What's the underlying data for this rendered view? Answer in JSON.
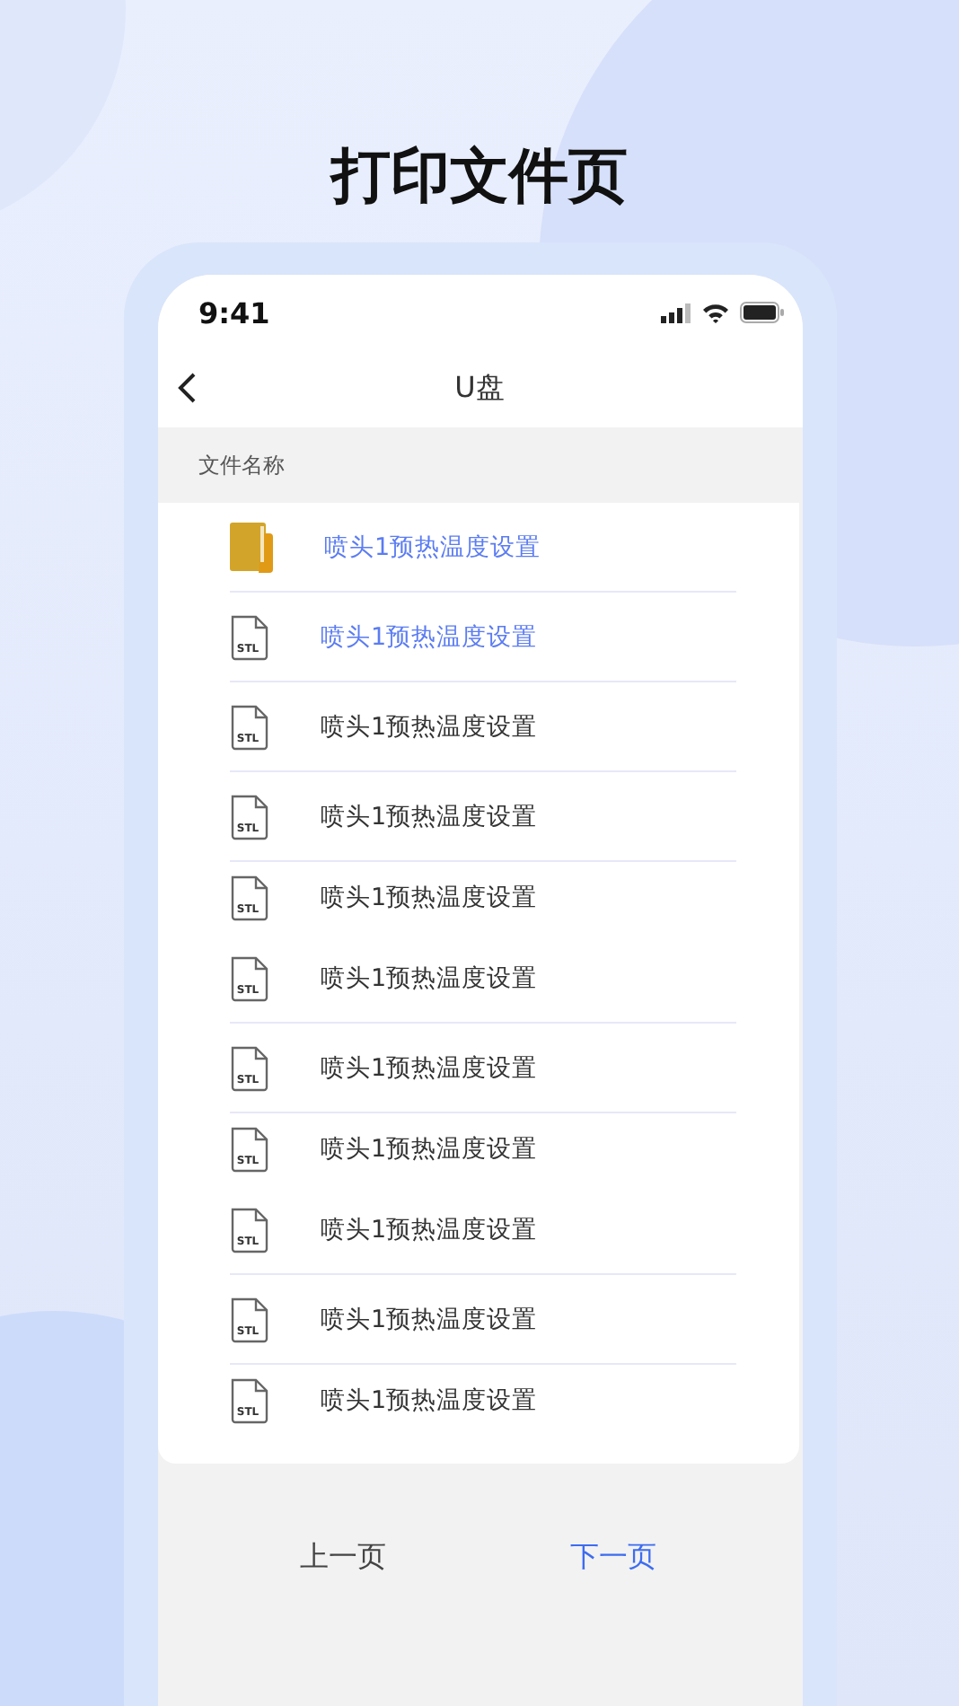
{
  "page_title": "打印文件页",
  "status_bar": {
    "time": "9:41"
  },
  "nav": {
    "title": "U盘"
  },
  "list_header": "文件名称",
  "files": [
    {
      "kind": "folder",
      "name": "喷头1预热温度设置",
      "selected": true,
      "divider": true
    },
    {
      "kind": "stl",
      "badge": "STL",
      "name": "喷头1预热温度设置",
      "selected": true,
      "divider": true
    },
    {
      "kind": "stl",
      "badge": "STL",
      "name": "喷头1预热温度设置",
      "selected": false,
      "divider": true
    },
    {
      "kind": "stl",
      "badge": "STL",
      "name": "喷头1预热温度设置",
      "selected": false,
      "divider": true
    },
    {
      "kind": "stl",
      "badge": "STL",
      "name": "喷头1预热温度设置",
      "selected": false,
      "divider": false
    },
    {
      "kind": "stl",
      "badge": "STL",
      "name": "喷头1预热温度设置",
      "selected": false,
      "divider": true
    },
    {
      "kind": "stl",
      "badge": "STL",
      "name": "喷头1预热温度设置",
      "selected": false,
      "divider": true
    },
    {
      "kind": "stl",
      "badge": "STL",
      "name": "喷头1预热温度设置",
      "selected": false,
      "divider": false
    },
    {
      "kind": "stl",
      "badge": "STL",
      "name": "喷头1预热温度设置",
      "selected": false,
      "divider": true
    },
    {
      "kind": "stl",
      "badge": "STL",
      "name": "喷头1预热温度设置",
      "selected": false,
      "divider": true
    },
    {
      "kind": "stl",
      "badge": "STL",
      "name": "喷头1预热温度设置",
      "selected": false,
      "divider": false
    }
  ],
  "pager": [
    {
      "label": "上一页",
      "selected": false
    },
    {
      "label": "下一页",
      "selected": true
    }
  ]
}
